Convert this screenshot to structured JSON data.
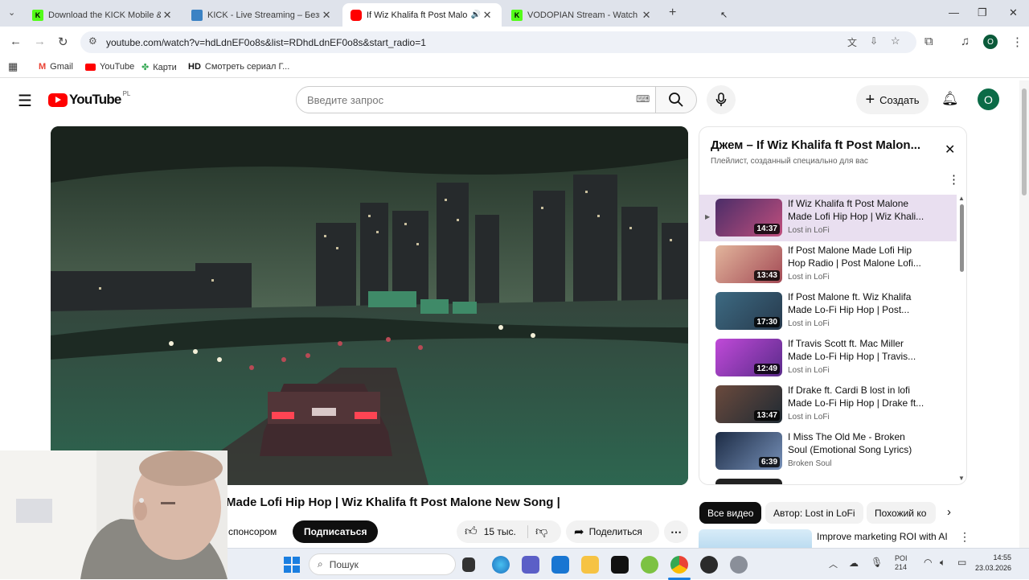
{
  "browser": {
    "tabs": [
      {
        "title": "Download the KICK Mobile & T",
        "favicon_color": "#53fc18",
        "active": false
      },
      {
        "title": "KICK - Live Streaming – Безкош",
        "favicon_color": "#3b82c4",
        "active": false
      },
      {
        "title": "If Wiz Khalifa ft Post Malone",
        "favicon_color": "#ff0000",
        "active": true
      },
      {
        "title": "VODOPIAN Stream - Watch Live",
        "favicon_color": "#53fc18",
        "active": false
      }
    ],
    "url": "youtube.com/watch?v=hdLdnEF0o8s&list=RDhdLdnEF0o8s&start_radio=1",
    "bookmarks": [
      {
        "label": "Gmail"
      },
      {
        "label": "YouTube"
      },
      {
        "label": "Карти"
      },
      {
        "label": "Смотреть сериал Г..."
      }
    ],
    "bookmark_hd": "HD"
  },
  "youtube": {
    "logo_text": "YouTube",
    "logo_region": "PL",
    "search_placeholder": "Введите запрос",
    "create_label": "Создать",
    "avatar_letter": "O"
  },
  "video": {
    "title": "Made Lofi Hip Hop | Wiz Khalifa ft Post Malone New Song |",
    "sponsor_text": "спонсором",
    "subscribe_label": "Подписаться",
    "likes": "15 тыс.",
    "share_label": "Поделиться"
  },
  "playlist": {
    "title": "Джем – If Wiz Khalifa ft Post Malon...",
    "subtitle": "Плейлист, созданный специально для вас",
    "items": [
      {
        "title": "If Wiz Khalifa ft Post Malone Made Lofi Hip Hop | Wiz Khali...",
        "channel": "Lost in LoFi",
        "duration": "14:37",
        "active": true,
        "thumb_color": "#7a3b6b"
      },
      {
        "title": "If Post Malone Made Lofi Hip Hop Radio | Post Malone Lofi...",
        "channel": "Lost in LoFi",
        "duration": "13:43",
        "active": false,
        "thumb_color": "#c77a6a"
      },
      {
        "title": "If Post Malone ft. Wiz Khalifa Made Lo-Fi Hip Hop | Post...",
        "channel": "Lost in LoFi",
        "duration": "17:30",
        "active": false,
        "thumb_color": "#3e5e78"
      },
      {
        "title": "If Travis Scott ft. Mac Miller Made Lo-Fi Hip Hop | Travis...",
        "channel": "Lost in LoFi",
        "duration": "12:49",
        "active": false,
        "thumb_color": "#a14bd0"
      },
      {
        "title": "If Drake ft. Cardi B lost in lofi Made Lo-Fi Hip Hop | Drake ft...",
        "channel": "Lost in LoFi",
        "duration": "13:47",
        "active": false,
        "thumb_color": "#4a3a3a"
      },
      {
        "title": "I Miss The Old Me - Broken Soul (Emotional Song Lyrics)",
        "channel": "Broken Soul",
        "duration": "6:39",
        "active": false,
        "thumb_color": "#2a3a52"
      }
    ]
  },
  "chips": [
    {
      "label": "Все видео",
      "active": true
    },
    {
      "label": "Автор: Lost in LoFi",
      "active": false
    },
    {
      "label": "Похожий ко",
      "active": false
    }
  ],
  "ad": {
    "title": "Improve marketing ROI with AI"
  },
  "taskbar": {
    "search_placeholder": "Пошук",
    "tray_label1": "POI",
    "tray_label2": "214",
    "time": "14:55",
    "date": "23.03.2026"
  }
}
